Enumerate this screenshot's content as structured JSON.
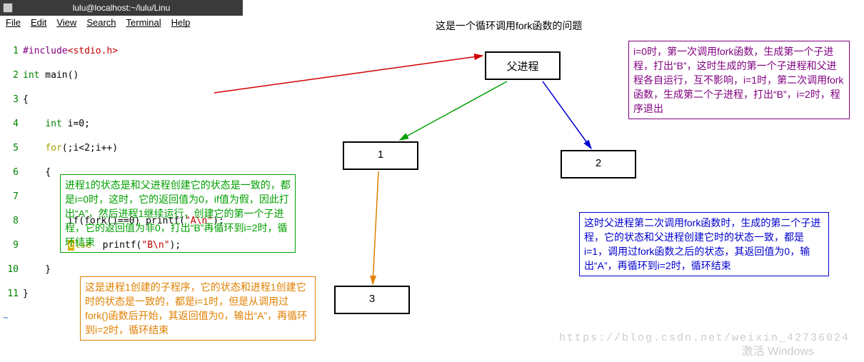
{
  "window": {
    "title": "lulu@localhost:~/lulu/Linu"
  },
  "menu": {
    "file": "File",
    "edit": "Edit",
    "view": "View",
    "search": "Search",
    "terminal": "Terminal",
    "help": "Help"
  },
  "code": {
    "l1_directive": "#include",
    "l1_header": "<stdio.h>",
    "l2_type": "int",
    "l2_rest": " main()",
    "l3": "{",
    "l4_type": "int",
    "l4_rest": " i=0;",
    "l5_for": "for",
    "l5_rest": "(;i<2;i++)",
    "l6": "{",
    "l8_pre": "        if(fork()==0) printf(",
    "l8_str": "\"A\\n\"",
    "l8_post": ");",
    "l9_pre": "        ",
    "l9_else": "e",
    "l9_else2": "lse",
    "l9_mid": "  printf(",
    "l9_str": "\"B\\n\"",
    "l9_post": ");",
    "l10": "    }",
    "l11": "}"
  },
  "diagram": {
    "title": "这是一个循环调用fork函数的问题",
    "parent": "父进程",
    "node1": "1",
    "node2": "2",
    "node3": "3"
  },
  "explain": {
    "green": "进程1的状态是和父进程创建它的状态是一致的，都是i=0时，这时，它的返回值为0，if值为假，因此打出“A”，然后进程1继续运行，创建它的第一个子进程，它的返回值为非0，打出“B”再循环到i=2时，循环结束",
    "orange": "这是进程1创建的子程序，它的状态和进程1创建它时的状态是一致的，都是i=1时，但是从调用过fork()函数后开始，其返回值为0，输出“A”，再循环到i=2时，循环结束",
    "purple": "i=0时，第一次调用fork函数，生成第一个子进程，打出“B”，这时生成的第一个子进程和父进程各自运行，互不影响，i=1时，第二次调用fork函数，生成第二个子进程，打出“B”，i=2时，程序退出",
    "blue": "这时父进程第二次调用fork函数时，生成的第二个子进程，它的状态和父进程创建它时的状态一致，都是i=1，调用过fork函数之后的状态，其返回值为0，输出“A”，再循环到i=2时，循环结束"
  },
  "watermark": {
    "url": "https://blog.csdn.net/weixin_42736024",
    "win": "激活 Windows"
  }
}
